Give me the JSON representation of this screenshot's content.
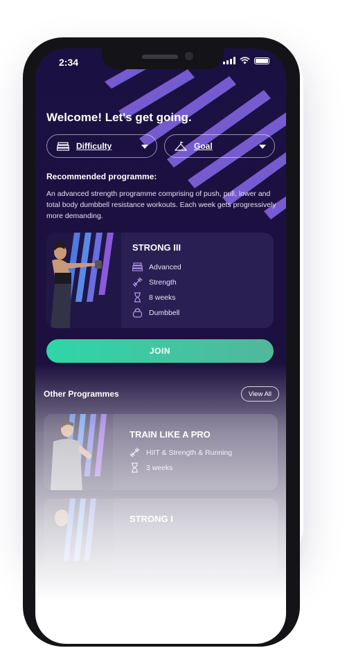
{
  "status_bar": {
    "time": "2:34"
  },
  "welcome": "Welcome! Let's get going.",
  "filters": {
    "difficulty": {
      "label": "Difficulty",
      "icon": "difficulty-icon"
    },
    "goal": {
      "label": "Goal",
      "icon": "mountain-flag-icon"
    }
  },
  "recommended": {
    "heading": "Recommended programme:",
    "description": "An advanced strength programme comprising of push, pull, lower and total body dumbbell resistance workouts. Each week gets progressively more demanding.",
    "card": {
      "title": "STRONG III",
      "features": [
        {
          "icon": "difficulty-icon",
          "label": "Advanced"
        },
        {
          "icon": "dumbbell-icon",
          "label": "Strength"
        },
        {
          "icon": "hourglass-icon",
          "label": "8 weeks"
        },
        {
          "icon": "kettlebell-icon",
          "label": "Dumbbell"
        }
      ]
    },
    "join_label": "JOIN"
  },
  "other": {
    "heading": "Other Programmes",
    "view_all": "View All",
    "programmes": [
      {
        "title": "TRAIN LIKE A PRO",
        "features": [
          {
            "icon": "dumbbell-icon",
            "label": "HIIT & Strength & Running"
          },
          {
            "icon": "hourglass-icon",
            "label": "3 weeks"
          }
        ]
      },
      {
        "title": "STRONG I"
      }
    ]
  },
  "colors": {
    "background": "#1a1142",
    "card": "#2a1f52",
    "accent_green": "#2fd6a8",
    "stripe_purple": "#8a4fd9",
    "stripe_blue": "#4f7ae0"
  }
}
